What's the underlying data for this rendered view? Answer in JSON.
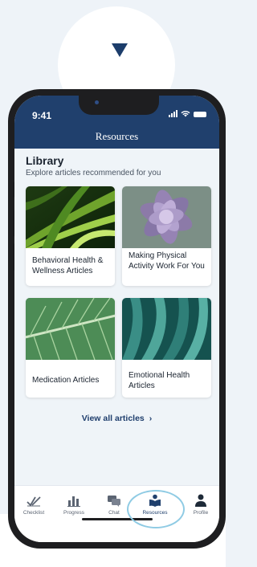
{
  "app": {
    "status_time": "9:41",
    "nav_title": "Resources"
  },
  "library": {
    "title": "Library",
    "subtitle": "Explore articles recommended for you"
  },
  "articles": [
    {
      "title": "Behavioral Health & Wellness Articles",
      "image": "green-agave-leaves"
    },
    {
      "title": "Making Physical Activity Work For You",
      "image": "purple-succulent"
    },
    {
      "title": "Medication Articles",
      "image": "leaf-veins-closeup"
    },
    {
      "title": "Emotional Health Articles",
      "image": "teal-plant-leaves"
    }
  ],
  "view_all": {
    "label": "View all articles"
  },
  "tabs": [
    {
      "label": "Checklist",
      "icon": "checklist-icon",
      "active": false
    },
    {
      "label": "Progress",
      "icon": "bar-chart-icon",
      "active": false
    },
    {
      "label": "Chat",
      "icon": "chat-icon",
      "active": false
    },
    {
      "label": "Resources",
      "icon": "book-reader-icon",
      "active": true
    },
    {
      "label": "Profile",
      "icon": "profile-icon",
      "active": false
    }
  ],
  "colors": {
    "header": "#20406d",
    "highlight_ring": "#8fcbe4",
    "background": "#eef3f8"
  }
}
